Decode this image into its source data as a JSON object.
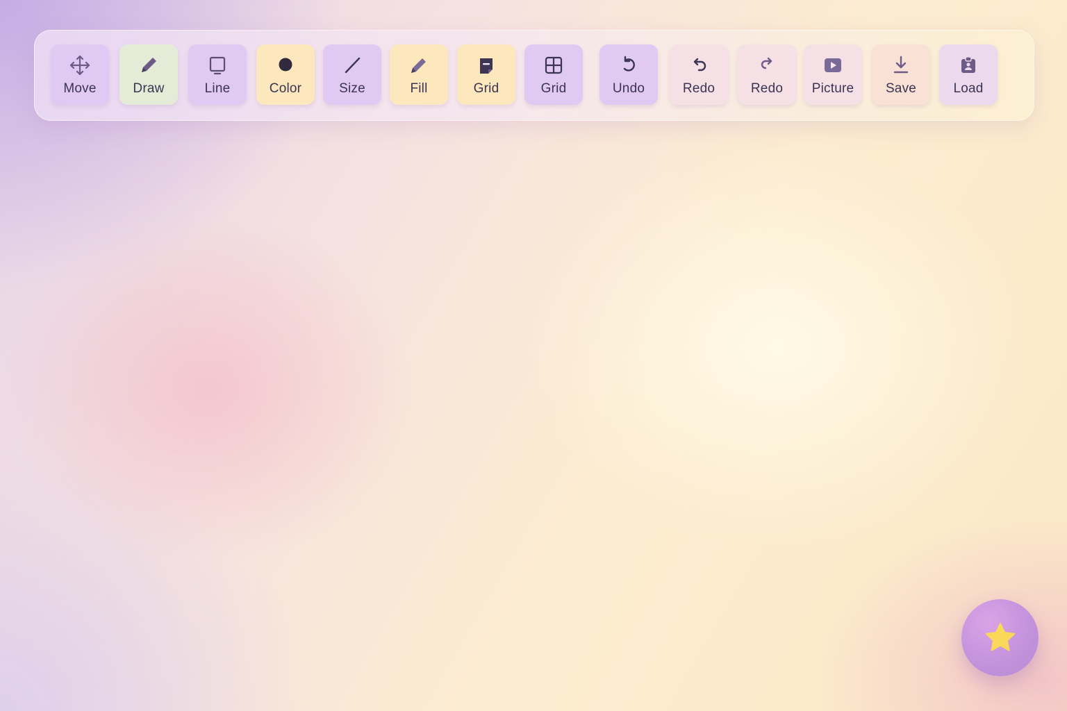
{
  "toolbar": {
    "tools": [
      {
        "label": "Move",
        "icon": "move-icon"
      },
      {
        "label": "Draw",
        "icon": "pencil-icon"
      },
      {
        "label": "Line",
        "icon": "square-icon"
      },
      {
        "label": "Color",
        "icon": "circle-icon"
      },
      {
        "label": "Size",
        "icon": "line-icon"
      },
      {
        "label": "Fill",
        "icon": "pencil-icon"
      },
      {
        "label": "Grid",
        "icon": "note-icon"
      },
      {
        "label": "Grid",
        "icon": "grid-icon"
      },
      {
        "label": "Undo",
        "icon": "undo-icon"
      },
      {
        "label": "Redo",
        "icon": "undo-arrow-icon"
      },
      {
        "label": "Redo",
        "icon": "redo-icon"
      },
      {
        "label": "Picture",
        "icon": "play-icon"
      },
      {
        "label": "Save",
        "icon": "download-icon"
      },
      {
        "label": "Load",
        "icon": "clipboard-icon"
      }
    ]
  },
  "fab": {
    "icon": "star-icon"
  },
  "colors": {
    "icon": "#6b5b86",
    "icon_dark": "#3b3452",
    "star": "#f9d85a",
    "fab": "#c393dc"
  }
}
